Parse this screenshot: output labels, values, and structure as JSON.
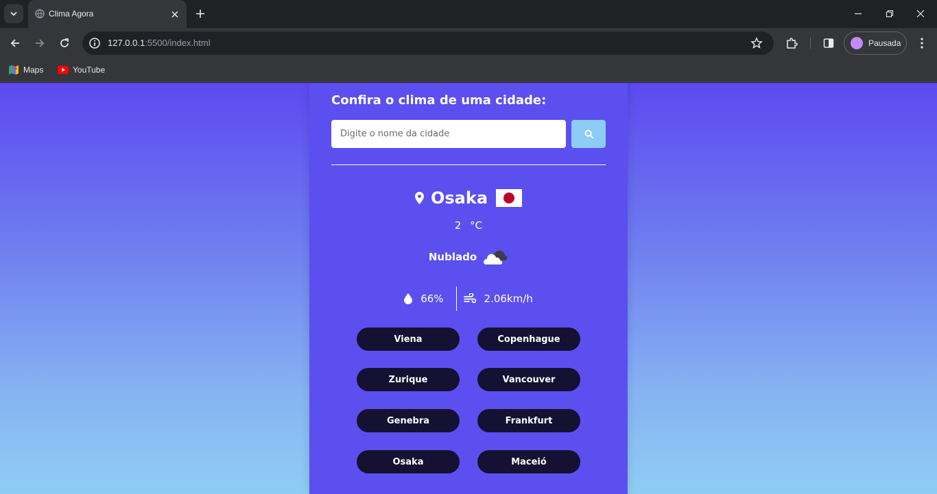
{
  "browser": {
    "tab_title": "Clima Agora",
    "url_host": "127.0.0.1",
    "url_rest": ":5500/index.html",
    "profile_label": "Pausada",
    "bookmarks": [
      {
        "label": "Maps"
      },
      {
        "label": "YouTube"
      }
    ]
  },
  "page": {
    "title": "Confira o clima de uma cidade:",
    "search": {
      "placeholder": "Digite o nome da cidade",
      "value": ""
    },
    "weather": {
      "city": "Osaka",
      "temperature": "2",
      "unit": "°C",
      "description": "Nublado",
      "humidity": "66%",
      "wind": "2.06km/h"
    },
    "suggestions": [
      "Viena",
      "Copenhague",
      "Zurique",
      "Vancouver",
      "Genebra",
      "Frankfurt",
      "Osaka",
      "Maceió"
    ]
  },
  "colors": {
    "accent": "#5b4ff0",
    "search_button": "#8dccf5",
    "suggestion_button": "#141132",
    "flag_red": "#bc002d"
  },
  "icons": {
    "location": "map-marker-icon",
    "weather": "cloud-icon",
    "humidity": "droplet-icon",
    "wind": "wind-icon",
    "search": "magnifier-icon"
  }
}
